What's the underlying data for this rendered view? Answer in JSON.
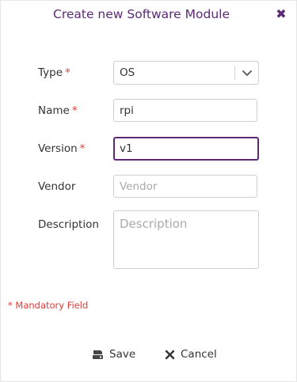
{
  "dialog": {
    "title": "Create new Software Module",
    "close_icon": "close-icon"
  },
  "form": {
    "type": {
      "label": "Type",
      "required_mark": "*",
      "value": "OS"
    },
    "name": {
      "label": "Name",
      "required_mark": "*",
      "value": "rpi"
    },
    "version": {
      "label": "Version",
      "required_mark": "*",
      "value": "v1"
    },
    "vendor": {
      "label": "Vendor",
      "value": "",
      "placeholder": "Vendor"
    },
    "description": {
      "label": "Description",
      "value": "",
      "placeholder": "Description"
    }
  },
  "mandatory_note": "* Mandatory Field",
  "actions": {
    "save_label": "Save",
    "cancel_label": "Cancel"
  },
  "colors": {
    "accent": "#5b2a73",
    "required": "#e53935"
  }
}
